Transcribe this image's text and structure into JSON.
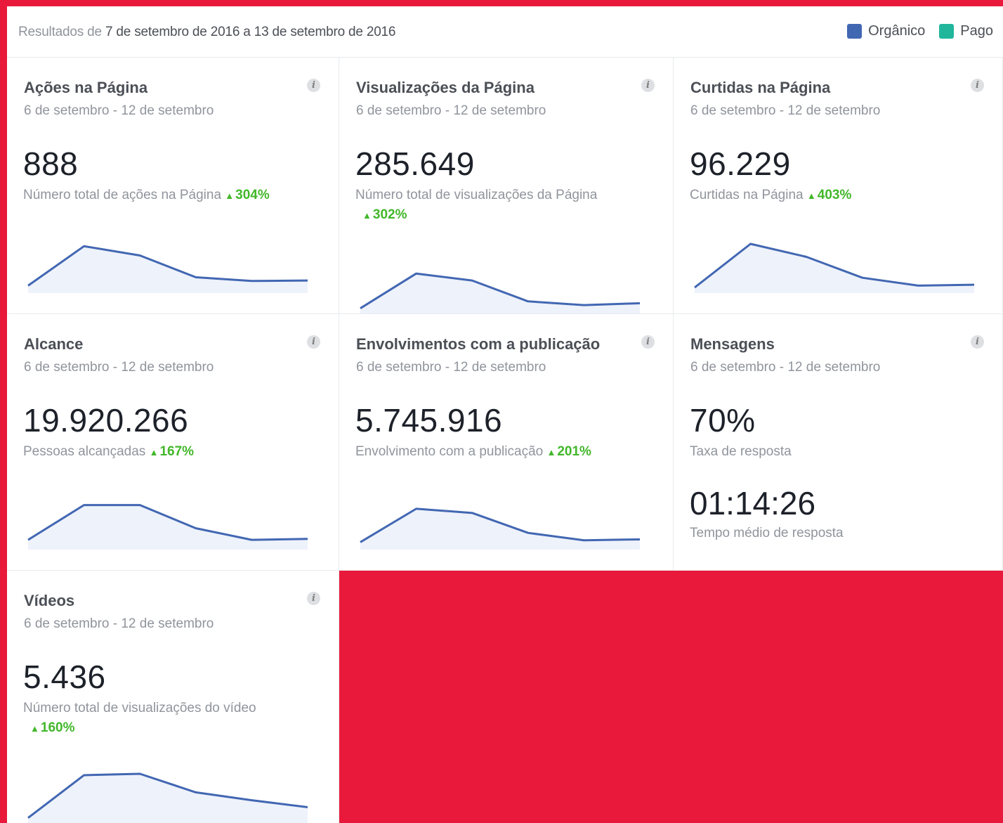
{
  "header": {
    "range_prefix": "Resultados de",
    "range_dates": "7 de setembro de 2016 a 13 de setembro de 2016",
    "legend": [
      {
        "label": "Orgânico",
        "color": "#4267b2"
      },
      {
        "label": "Pago",
        "color": "#20b69c"
      }
    ]
  },
  "colors": {
    "line": "#4267b2",
    "fill": "#eef2fb",
    "positive": "#42b72a"
  },
  "cards": [
    {
      "title": "Ações na Página",
      "period": "6 de setembro - 12 de setembro",
      "value": "888",
      "desc": "Número total de ações na Página",
      "change": "304%",
      "trend": [
        0.1,
        0.95,
        0.75,
        0.28,
        0.2,
        0.21
      ]
    },
    {
      "title": "Visualizações da Página",
      "period": "6 de setembro - 12 de setembro",
      "value": "285.649",
      "desc": "Número total de visualizações da Página",
      "change": "302%",
      "trend": [
        0.05,
        0.8,
        0.65,
        0.2,
        0.12,
        0.16
      ]
    },
    {
      "title": "Curtidas na Página",
      "period": "6 de setembro - 12 de setembro",
      "value": "96.229",
      "desc": "Curtidas na Página",
      "change": "403%",
      "trend": [
        0.06,
        1.0,
        0.72,
        0.27,
        0.1,
        0.12
      ]
    },
    {
      "title": "Alcance",
      "period": "6 de setembro - 12 de setembro",
      "value": "19.920.266",
      "desc": "Pessoas alcançadas",
      "change": "167%",
      "trend": [
        0.15,
        0.9,
        0.9,
        0.4,
        0.15,
        0.17
      ]
    },
    {
      "title": "Envolvimentos com a publicação",
      "period": "6 de setembro - 12 de setembro",
      "value": "5.745.916",
      "desc": "Envolvimento com a publicação",
      "change": "201%",
      "trend": [
        0.1,
        0.82,
        0.73,
        0.3,
        0.14,
        0.16
      ]
    },
    {
      "title": "Mensagens",
      "period": "6 de setembro - 12 de setembro",
      "value": "70%",
      "desc": "Taxa de resposta",
      "value2": "01:14:26",
      "desc2": "Tempo médio de resposta"
    },
    {
      "title": "Vídeos",
      "period": "6 de setembro - 12 de setembro",
      "value": "5.436",
      "desc": "Número total de visualizações do vídeo",
      "change": "160%",
      "trend": [
        0.05,
        0.97,
        1.0,
        0.6,
        0.43,
        0.28
      ]
    }
  ]
}
